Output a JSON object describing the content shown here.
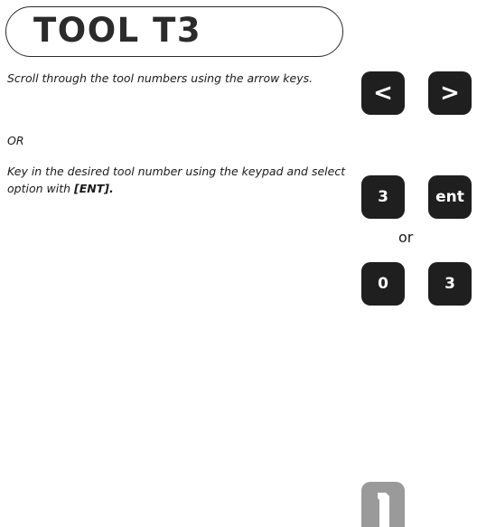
{
  "title": "TOOL  T3",
  "instructions": {
    "scroll": "Scroll through the tool numbers using the arrow keys.",
    "or": "OR",
    "keyin_prefix": "Key in the desired tool number using the keypad and select option with ",
    "keyin_key": "[ENT]."
  },
  "keys": {
    "left": "<",
    "right": ">",
    "three": "3",
    "ent": "ent",
    "or_label": "or",
    "zero": "0",
    "three_b": "3"
  },
  "icons": {
    "tool_key": "tool-icon"
  },
  "colors": {
    "key_bg": "#1f1f1f",
    "key_text": "#ffffff",
    "tool_key_bg": "#9a9a9a"
  }
}
